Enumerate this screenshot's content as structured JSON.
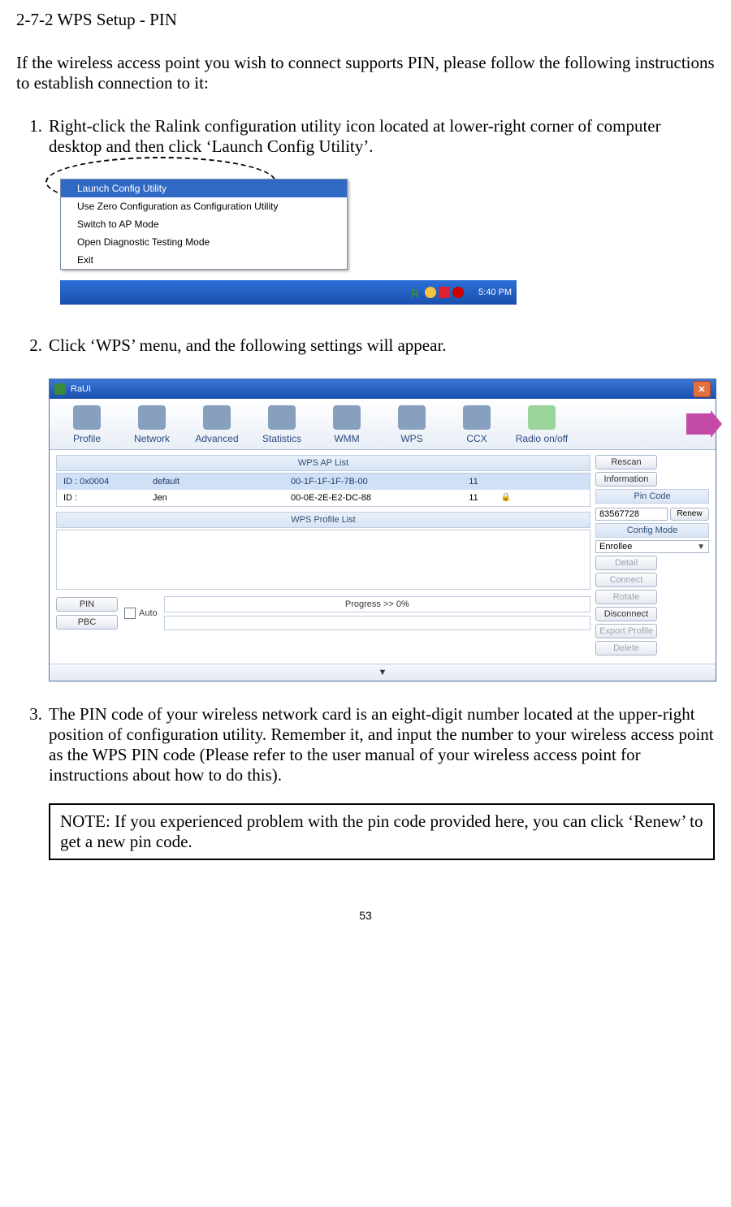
{
  "section_title": "2-7-2 WPS Setup - PIN",
  "intro": "If the wireless access point you wish to connect supports PIN, please follow the following instructions to establish connection to it:",
  "step1_num": "1.",
  "step1_text": "Right-click the Ralink configuration utility icon located at lower-right corner of computer desktop and then click ‘Launch Config Utility’.",
  "step2_num": "2.",
  "step2_text": "Click ‘WPS’ menu, and the following settings will appear.",
  "step3_num": "3.",
  "step3_text": "The PIN code of your wireless network card is an eight-digit number located at the upper-right position of configuration utility. Remember it, and input the number to your wireless access point as the WPS PIN code (Please refer to the user manual of your wireless access point for instructions about how to do this).",
  "note_text": "NOTE: If you experienced problem with the pin code provided here, you can click ‘Renew’ to get a new pin code.",
  "page_number": "53",
  "context_menu": {
    "items": [
      "Launch Config Utility",
      "Use Zero Configuration as Configuration Utility",
      "Switch to AP Mode",
      "Open Diagnostic Testing Mode",
      "Exit"
    ],
    "clock": "5:40 PM"
  },
  "raui": {
    "title": "RaUI",
    "tabs": [
      "Profile",
      "Network",
      "Advanced",
      "Statistics",
      "WMM",
      "WPS",
      "CCX",
      "Radio on/off"
    ],
    "aplist_header": "WPS AP List",
    "aplist": [
      {
        "id": "ID : 0x0004",
        "ssid": "default",
        "mac": "00-1F-1F-1F-7B-00",
        "ch": "11",
        "lock": ""
      },
      {
        "id": "ID :",
        "ssid": "Jen",
        "mac": "00-0E-2E-E2-DC-88",
        "ch": "11",
        "lock": "🔒"
      }
    ],
    "proflist_header": "WPS Profile List",
    "auto_label": "Auto",
    "progress": "Progress >> 0%",
    "right": {
      "rescan": "Rescan",
      "information": "Information",
      "pincode_label": "Pin Code",
      "pincode": "83567728",
      "renew": "Renew",
      "configmode_label": "Config Mode",
      "configmode": "Enrollee",
      "detail": "Detail",
      "connect": "Connect",
      "rotate": "Rotate",
      "disconnect": "Disconnect",
      "export": "Export Profile",
      "delete": "Delete"
    },
    "pin_btn": "PIN",
    "pbc_btn": "PBC",
    "expander": "▼"
  }
}
